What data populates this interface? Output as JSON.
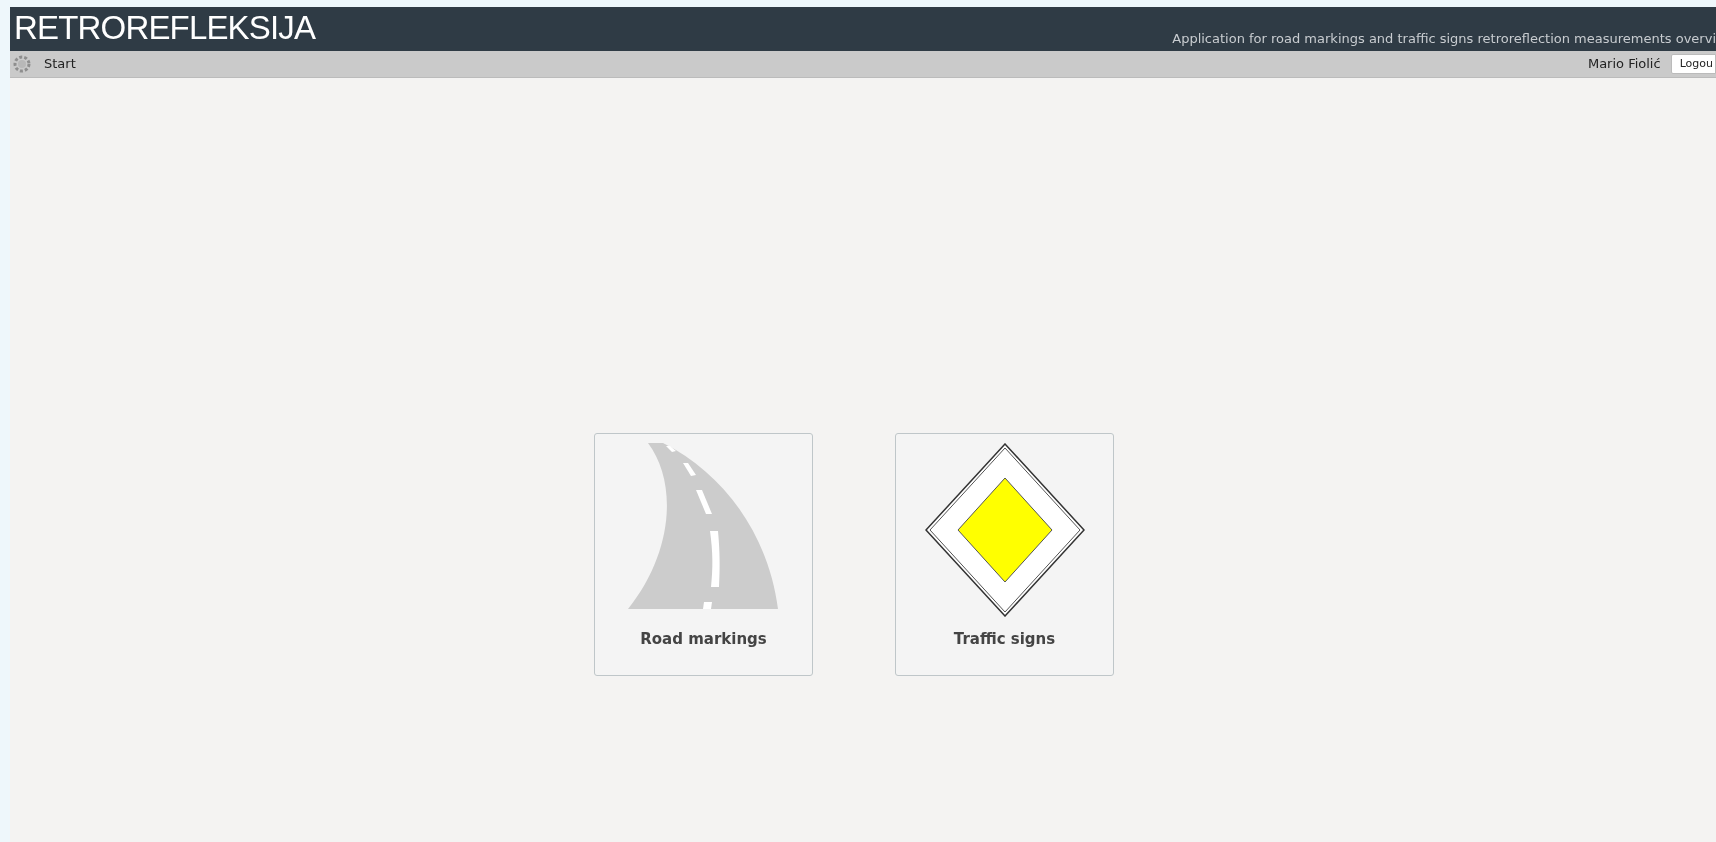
{
  "header": {
    "title": "RETROREFLEKSIJA",
    "subtitle": "Application for road markings and traffic signs retroreflection measurements overvi"
  },
  "toolbar": {
    "start": "Start",
    "user": "Mario Fiolić",
    "logout": "Logou"
  },
  "tiles": [
    {
      "kind": "road",
      "label": "Road markings"
    },
    {
      "kind": "sign",
      "label": "Traffic signs"
    }
  ]
}
